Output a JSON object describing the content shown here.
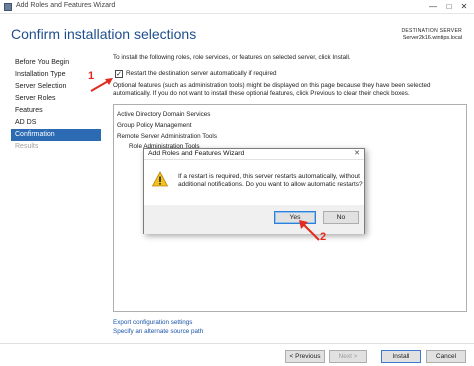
{
  "window": {
    "title": "Add Roles and Features Wizard",
    "min_glyph": "—",
    "max_glyph": "□",
    "close_glyph": "✕"
  },
  "header": {
    "title": "Confirm installation selections",
    "destination_label": "DESTINATION SERVER",
    "destination_server": "Server2k16.wintips.local"
  },
  "nav": {
    "items": [
      {
        "label": "Before You Begin",
        "state": "normal"
      },
      {
        "label": "Installation Type",
        "state": "normal"
      },
      {
        "label": "Server Selection",
        "state": "normal"
      },
      {
        "label": "Server Roles",
        "state": "normal"
      },
      {
        "label": "Features",
        "state": "normal"
      },
      {
        "label": "AD DS",
        "state": "normal"
      },
      {
        "label": "Confirmation",
        "state": "active"
      },
      {
        "label": "Results",
        "state": "disabled"
      }
    ]
  },
  "content": {
    "intro": "To install the following roles, role services, or features on selected server, click Install.",
    "restart_checkbox": {
      "label": "Restart the destination server automatically if required",
      "checked": true,
      "check_glyph": "✓"
    },
    "optional_line1": "Optional features (such as administration tools) might be displayed on this page because they have been selected",
    "optional_line2": "automatically. If you do not want to install these optional features, click Previous to clear their check boxes."
  },
  "features": {
    "items": [
      "Active Directory Domain Services",
      "Group Policy Management",
      "Remote Server Administration Tools",
      "Role Administration Tools"
    ]
  },
  "links": {
    "export": "Export configuration settings",
    "alternate_source": "Specify an alternate source path"
  },
  "footer": {
    "previous": "< Previous",
    "next": "Next >",
    "install": "Install",
    "cancel": "Cancel"
  },
  "dialog": {
    "title": "Add Roles and Features Wizard",
    "close_glyph": "✕",
    "message_line1": "If a restart is required, this server restarts automatically, without",
    "message_line2": "additional notifications. Do you want to allow automatic restarts?",
    "yes": "Yes",
    "no": "No",
    "icon": "warning-icon"
  },
  "annotations": {
    "step1": "1",
    "step2": "2",
    "color": "#e22a1e"
  },
  "colors": {
    "accent": "#2c6bb4",
    "title": "#1f4e8c",
    "link": "#1a55a8"
  }
}
